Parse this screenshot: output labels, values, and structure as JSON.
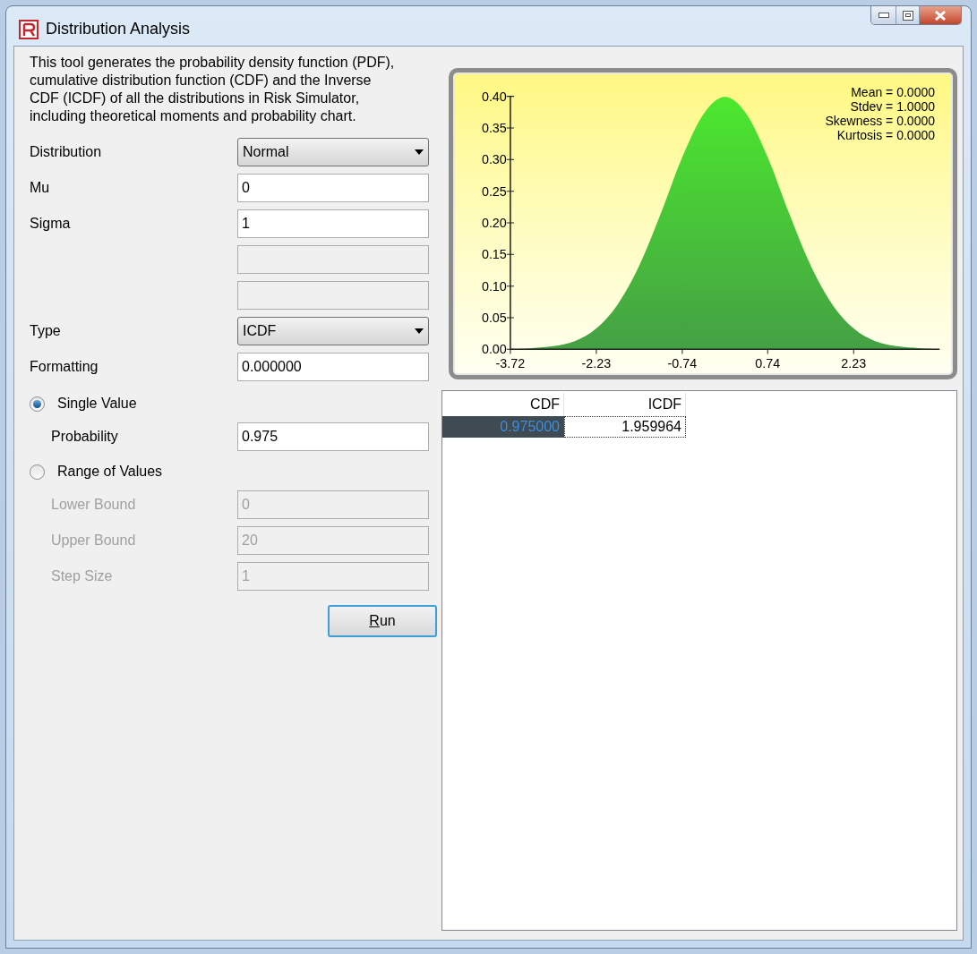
{
  "window": {
    "title": "Distribution Analysis"
  },
  "description": "This tool generates the probability density function (PDF), cumulative distribution function (CDF) and the Inverse CDF (ICDF) of all the distributions in Risk Simulator, including theoretical moments and probability chart.",
  "form": [
    {
      "kind": "dropdown",
      "label": "Distribution",
      "value": "Normal"
    },
    {
      "kind": "text",
      "label": "Mu",
      "value": "0",
      "disabled": false
    },
    {
      "kind": "text",
      "label": "Sigma",
      "value": "1",
      "disabled": false
    },
    {
      "kind": "text",
      "disabled": true
    },
    {
      "kind": "text",
      "disabled": true
    },
    {
      "kind": "dropdown",
      "label": "Type",
      "value": "ICDF"
    },
    {
      "kind": "text",
      "label": "Formatting",
      "value": "0.000000",
      "disabled": false
    }
  ],
  "modes": [
    {
      "label": "Single Value",
      "selected": true,
      "fields": [
        {
          "label": "Probability",
          "value": "0.975",
          "disabled": false
        }
      ]
    },
    {
      "label": "Range of Values",
      "selected": false,
      "fields": [
        {
          "label": "Lower Bound",
          "value": "0",
          "disabled": true
        },
        {
          "label": "Upper Bound",
          "value": "20",
          "disabled": true
        },
        {
          "label": "Step Size",
          "value": "1",
          "disabled": true
        }
      ]
    }
  ],
  "run_button": "Run",
  "chart": {
    "stats": [
      "Mean = 0.0000",
      "Stdev = 1.0000",
      "Skewness = 0.0000",
      "Kurtosis = 0.0000"
    ],
    "chart_data": {
      "type": "area",
      "x": [
        -3.72,
        -3.348,
        -2.976,
        -2.604,
        -2.232,
        -1.86,
        -1.488,
        -1.116,
        -0.744,
        -0.372,
        0,
        0.372,
        0.744,
        1.116,
        1.488,
        1.86,
        2.232,
        2.604,
        2.976,
        3.348,
        3.72
      ],
      "series": [
        {
          "color": "#44a044",
          "values": [
            0,
            0.002,
            0.005,
            0.013,
            0.033,
            0.071,
            0.132,
            0.214,
            0.303,
            0.372,
            0.399,
            0.372,
            0.303,
            0.214,
            0.132,
            0.071,
            0.033,
            0.013,
            0.005,
            0.002,
            0
          ]
        }
      ],
      "xlim": [
        -3.72,
        3.72
      ],
      "ylim": [
        0,
        0.4
      ],
      "xticks": [
        {
          "value": -3.72,
          "label": "-3.72"
        },
        {
          "value": -2.23,
          "label": "-2.23"
        },
        {
          "value": -0.74,
          "label": "-0.74"
        },
        {
          "value": 0.74,
          "label": "0.74"
        },
        {
          "value": 2.23,
          "label": "2.23"
        }
      ],
      "yticks": [
        {
          "value": 0,
          "label": "0.00"
        },
        {
          "value": 0.05,
          "label": "0.05"
        },
        {
          "value": 0.1,
          "label": "0.10"
        },
        {
          "value": 0.15,
          "label": "0.15"
        },
        {
          "value": 0.2,
          "label": "0.20"
        },
        {
          "value": 0.25,
          "label": "0.25"
        },
        {
          "value": 0.3,
          "label": "0.30"
        },
        {
          "value": 0.35,
          "label": "0.35"
        },
        {
          "value": 0.4,
          "label": "0.40"
        }
      ]
    }
  },
  "results": {
    "columns": [
      "CDF",
      "ICDF"
    ],
    "rows": [
      [
        {
          "value": "0.975000",
          "selected": true,
          "focused": false
        },
        {
          "value": "1.959964",
          "selected": false,
          "focused": true
        }
      ]
    ]
  }
}
